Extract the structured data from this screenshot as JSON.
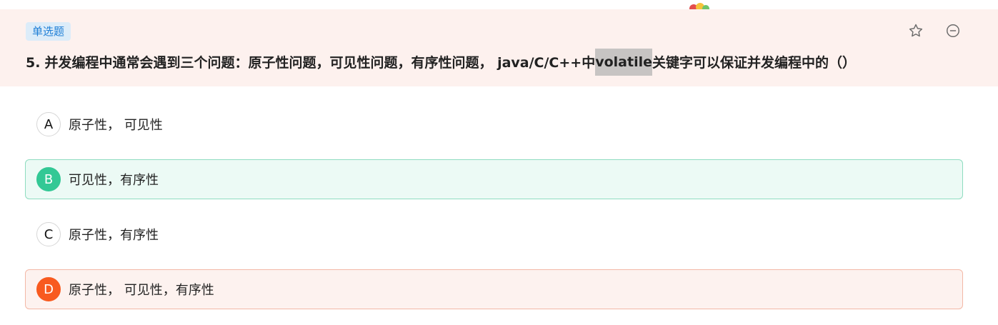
{
  "question": {
    "type_label": "单选题",
    "number": "5.",
    "text_before": "并发编程中通常会遇到三个问题：原子性问题，可见性问题，有序性问题， java/C/C++中",
    "highlighted": "volatile",
    "text_after": "关键字可以保证并发编程中的（）"
  },
  "header_icons": {
    "favorite": "star-icon",
    "remove": "minus-circle-icon",
    "mascot": "mascot-icon"
  },
  "options": [
    {
      "letter": "A",
      "text": "原子性， 可见性",
      "state": "normal"
    },
    {
      "letter": "B",
      "text": "可见性，有序性",
      "state": "correct"
    },
    {
      "letter": "C",
      "text": "原子性，有序性",
      "state": "normal"
    },
    {
      "letter": "D",
      "text": "原子性， 可见性，有序性",
      "state": "wrong"
    }
  ],
  "colors": {
    "header_bg": "#fdf1ee",
    "tag_text": "#1f7fd6",
    "correct": "#33c895",
    "wrong": "#f85a1f",
    "highlight": "#c7c4c3"
  }
}
